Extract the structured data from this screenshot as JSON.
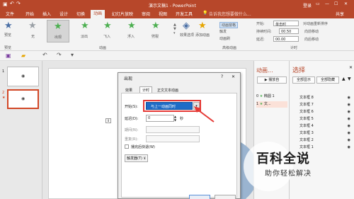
{
  "window": {
    "title": "演示文稿1 - PowerPoint",
    "login": "登录",
    "controls": [
      "▭",
      "—",
      "☐",
      "✕"
    ]
  },
  "menu": {
    "items": [
      "文件",
      "开始",
      "插入",
      "设计",
      "切换",
      "动画",
      "幻灯片放映",
      "审阅",
      "视图",
      "开发工具"
    ],
    "active_index": 5,
    "tellme": "告诉我您想要做什么...",
    "share": "共享"
  },
  "ribbon": {
    "preview": {
      "label": "预览",
      "group": "预览"
    },
    "animations": [
      {
        "label": "无",
        "color": "#9aa0a6"
      },
      {
        "label": "出现",
        "color": "#4caf50"
      },
      {
        "label": "淡出",
        "color": "#4caf50"
      },
      {
        "label": "飞入",
        "color": "#4caf50"
      },
      {
        "label": "浮入",
        "color": "#4caf50"
      },
      {
        "label": "劈裂",
        "color": "#4caf50"
      }
    ],
    "group_anim": "动画",
    "effect_options": "效果选项",
    "add_animation": "添加动画",
    "anim_pane_btn": "动画窗格",
    "trigger_btn": "触发",
    "anim_painter": "动画刷",
    "group_adv": "高级动画",
    "timing": {
      "start_label": "开始:",
      "start_value": "单击时",
      "duration_label": "持续时间:",
      "duration_value": "00.50",
      "delay_label": "延迟:",
      "delay_value": "00.00",
      "reorder_title": "对动画重新排序",
      "move_earlier": "向前移动",
      "move_later": "向后移动",
      "group": "计时"
    }
  },
  "slides": [
    {
      "num": "1"
    },
    {
      "num": "2"
    }
  ],
  "dialog": {
    "title": "出现",
    "help": "?",
    "close": "✕",
    "tabs": [
      "效果",
      "计时",
      "正文文本动画"
    ],
    "active_tab": 1,
    "start_label": "开始(S):",
    "start_value": "与上一动画同时",
    "delay_label": "延迟(D):",
    "delay_value": "0",
    "delay_unit": "秒",
    "period_label": "期间(N):",
    "repeat_label": "重复(R):",
    "rewind_label": "播完后快退(W)",
    "trigger_label": "触发器(T) ⊻"
  },
  "anim_pane": {
    "title": "动画...",
    "play": "▶ 播放自",
    "items": [
      {
        "num": "0",
        "label": "椭圆 1"
      },
      {
        "num": "1",
        "label": "文..."
      }
    ]
  },
  "selection_pane": {
    "title": "选择",
    "show_all": "全部显示",
    "hide_all": "全部隐藏",
    "items": [
      "文本框 8",
      "文本框 7",
      "文本框 6",
      "文本框 5",
      "文本框 4",
      "文本框 3",
      "文本框 2",
      "文本框 1"
    ]
  },
  "watermark": {
    "title": "百科全说",
    "subtitle": "助你轻松解决"
  },
  "colors": {
    "accent": "#b7472a",
    "highlight": "#d24726",
    "selected_field": "#1e6cc7",
    "callout": "#e53935"
  }
}
